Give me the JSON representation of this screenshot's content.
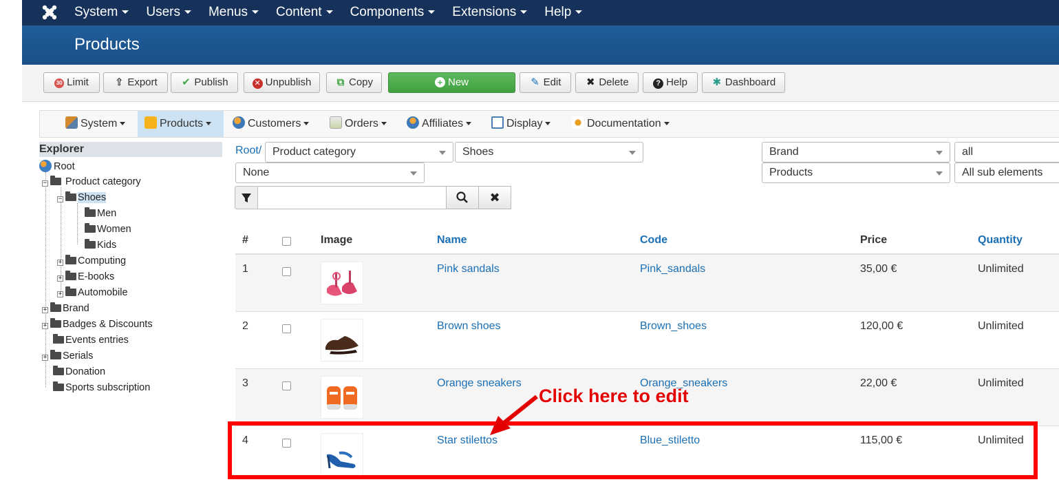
{
  "topmenu": {
    "items": [
      "System",
      "Users",
      "Menus",
      "Content",
      "Components",
      "Extensions",
      "Help"
    ]
  },
  "page_title": "Products",
  "toolbar": {
    "limit": "Limit",
    "export": "Export",
    "publish": "Publish",
    "unpublish": "Unpublish",
    "copy": "Copy",
    "new": "New",
    "edit": "Edit",
    "delete": "Delete",
    "help": "Help",
    "dashboard": "Dashboard"
  },
  "component_menu": {
    "items": [
      "System",
      "Products",
      "Customers",
      "Orders",
      "Affiliates",
      "Display",
      "Documentation"
    ],
    "active": "Products"
  },
  "explorer": {
    "title": "Explorer",
    "root": "Root",
    "product_category": "Product category",
    "shoes": "Shoes",
    "men": "Men",
    "women": "Women",
    "kids": "Kids",
    "computing": "Computing",
    "ebooks": "E-books",
    "automobile": "Automobile",
    "brand": "Brand",
    "badges": "Badges & Discounts",
    "events": "Events entries",
    "serials": "Serials",
    "donation": "Donation",
    "sports": "Sports subscription"
  },
  "filters": {
    "crumb": "Root/",
    "category_type": "Product category",
    "category_value": "Shoes",
    "none": "None",
    "brand": "Brand",
    "brand_value": "all",
    "products": "Products",
    "sub_elements": "All sub elements",
    "search_value": ""
  },
  "table": {
    "headers": {
      "num": "#",
      "image": "Image",
      "name": "Name",
      "code": "Code",
      "price": "Price",
      "quantity": "Quantity"
    },
    "rows": [
      {
        "num": "1",
        "name": "Pink sandals",
        "code": "Pink_sandals",
        "price": "35,00 €",
        "quantity": "Unlimited"
      },
      {
        "num": "2",
        "name": "Brown shoes",
        "code": "Brown_shoes",
        "price": "120,00 €",
        "quantity": "Unlimited"
      },
      {
        "num": "3",
        "name": "Orange sneakers",
        "code": "Orange_sneakers",
        "price": "22,00 €",
        "quantity": "Unlimited"
      },
      {
        "num": "4",
        "name": "Star stilettos",
        "code": "Blue_stiletto",
        "price": "115,00 €",
        "quantity": "Unlimited"
      }
    ]
  },
  "annotation": {
    "text": "Click here to edit",
    "color": "#e30000"
  },
  "colors": {
    "topbar": "#17325a",
    "titlebar": "#1f5d99",
    "link": "#1a6fb5",
    "new_button": "#5cb85c"
  }
}
